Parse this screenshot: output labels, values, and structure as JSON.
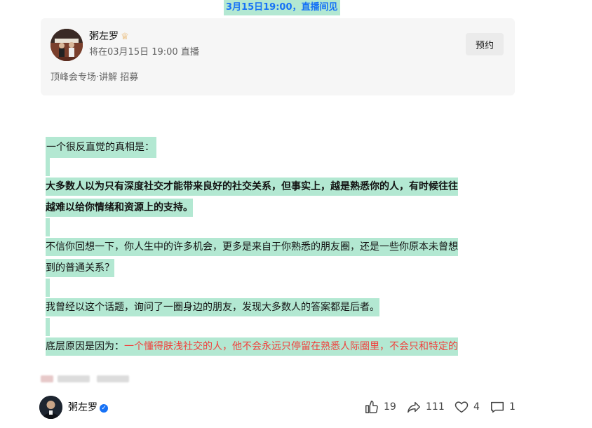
{
  "banner": {
    "text": "3月15日19:00，直播间见"
  },
  "live_card": {
    "author": "粥左罗",
    "schedule": "将在03月15日 19:00 直播",
    "tags": "顶峰会专场·讲解 招募",
    "reserve_label": "预约",
    "badge_icon": "crown-badge-icon"
  },
  "article": {
    "p1": "一个很反直觉的真相是：",
    "p2_line1": "大多数人以为只有深度社交才能带来良好的社交关系，但事实上，越是熟悉你的人，有时候往往",
    "p2_line2": "越难以给你情绪和资源上的支持。",
    "p3_line1": "不信你回想一下，你人生中的许多机会，更多是来自于你熟悉的朋友圈，还是一些你原本未曾想",
    "p3_line2": "到的普通关系？",
    "p4": "我曾经以这个话题，询问了一圈身边的朋友，发现大多数人的答案都是后者。",
    "p5_prefix": "底层原因是因为：",
    "p5_red": "一个懂得肤浅社交的人，他不会永远只停留在熟悉人际圈里，不会只和特定的"
  },
  "footer": {
    "author": "粥左罗",
    "verified_icon": "verified-check-icon",
    "like_count": "19",
    "share_count": "111",
    "favorite_count": "4",
    "comment_count": "1"
  },
  "colors": {
    "highlight": "#b3e8d2",
    "link_blue": "#1772f6",
    "red_text": "#f1403c",
    "card_bg": "#f6f6f6"
  }
}
